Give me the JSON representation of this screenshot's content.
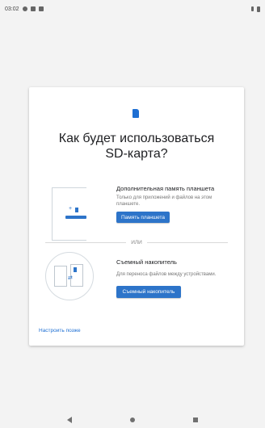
{
  "status_bar": {
    "time": "03:02",
    "left_icons": [
      "settings-icon",
      "image-icon",
      "sd-card-icon"
    ],
    "right_icons": [
      "wifi-icon",
      "battery-icon"
    ]
  },
  "dialog": {
    "icon": "sd-card-icon",
    "title_line1": "Как будет использоваться",
    "title_line2": "SD-карта?",
    "option1": {
      "illustration": "tablet-storage-illustration",
      "title": "Дополнительная память планшета",
      "description": "Только для приложений и файлов на этом планшете.",
      "button": "Память планшета"
    },
    "divider_text": "ИЛИ",
    "option2": {
      "illustration": "transfer-devices-illustration",
      "title": "Съемный накопитель",
      "description": "Для переноса файлов между устройствами.",
      "button": "Съемный накопитель"
    },
    "later_link": "Настроить позже"
  },
  "nav_bar": {
    "icons": [
      "back-icon",
      "home-icon",
      "recents-icon"
    ]
  },
  "colors": {
    "accent": "#2d74c9",
    "link": "#1e6fd3",
    "background": "#f3f3f3",
    "card": "#ffffff"
  }
}
